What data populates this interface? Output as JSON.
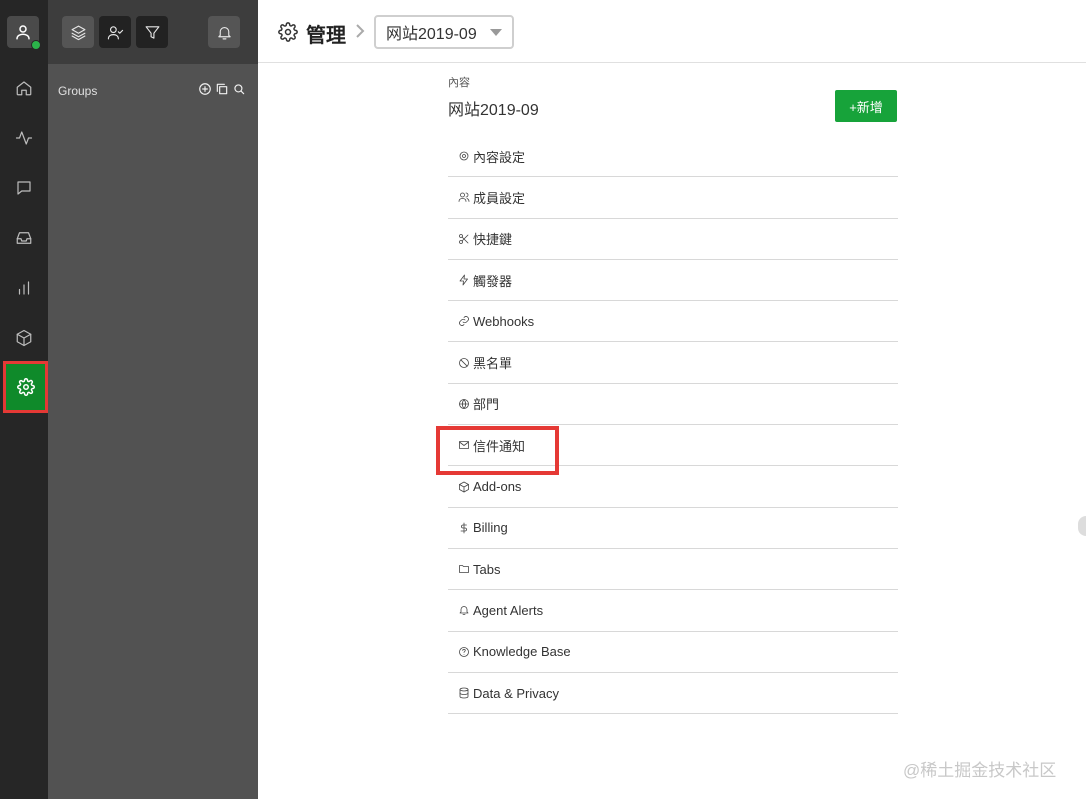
{
  "panel": {
    "groups_label": "Groups"
  },
  "header": {
    "title": "管理",
    "selected_site": "网站2019-09"
  },
  "content": {
    "section_label": "內容",
    "section_title": "网站2019-09",
    "add_button": "+新增"
  },
  "menu": [
    {
      "label": "內容設定",
      "icon": "gear-icon"
    },
    {
      "label": "成員設定",
      "icon": "users-icon"
    },
    {
      "label": "快捷鍵",
      "icon": "scissors-icon"
    },
    {
      "label": "觸發器",
      "icon": "lightning-icon"
    },
    {
      "label": "Webhooks",
      "icon": "link-icon"
    },
    {
      "label": "黑名單",
      "icon": "ban-icon"
    },
    {
      "label": "部門",
      "icon": "globe-icon"
    },
    {
      "label": "信件通知",
      "icon": "mail-icon"
    },
    {
      "label": "Add-ons",
      "icon": "box-icon"
    },
    {
      "label": "Billing",
      "icon": "dollar-icon"
    },
    {
      "label": "Tabs",
      "icon": "folder-icon"
    },
    {
      "label": "Agent Alerts",
      "icon": "bell-icon"
    },
    {
      "label": "Knowledge Base",
      "icon": "question-icon"
    },
    {
      "label": "Data & Privacy",
      "icon": "database-icon"
    }
  ],
  "watermark": "@稀土掘金技术社区",
  "colors": {
    "accent_green": "#17a33a",
    "active_rail": "#0f8a2a",
    "highlight_red": "#e53935"
  }
}
